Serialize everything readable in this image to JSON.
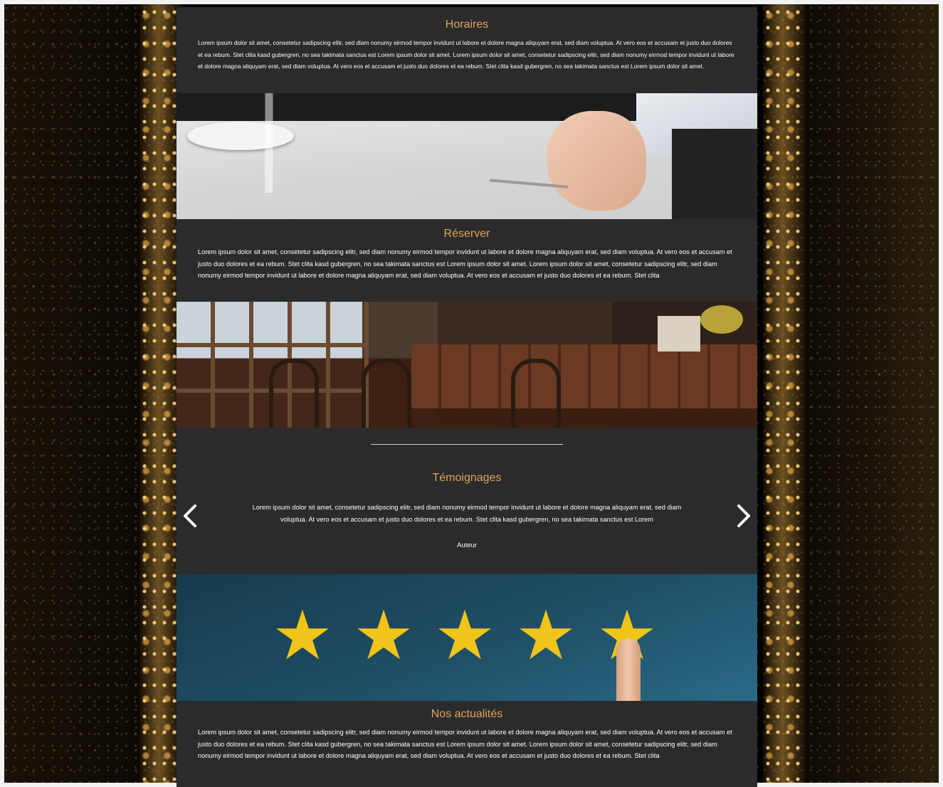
{
  "sections": {
    "horaires": {
      "title": "Horaires",
      "text": "Lorem ipsum dolor sit amet, consetetur sadipscing elitr, sed diam nonumy eirmod tempor invidunt ut labore et dolore magna aliquyam erat, sed diam voluptua. At vero eos et accusam et justo duo dolores et ea rebum. Stet clita kasd gubergren, no sea takimata sanctus est Lorem ipsum dolor sit amet. Lorem ipsum dolor sit amet, consetetur sadipscing elitr, sed diam nonumy eirmod tempor invidunt ut labore et dolore magna aliquyam erat, sed diam voluptua. At vero eos et accusam et justo duo dolores et ea rebum. Stet clita kasd gubergren, no sea takimata sanctus est Lorem ipsum dolor sit amet."
    },
    "reserver": {
      "title": "Réserver",
      "text": "Lorem ipsum dolor sit amet, consetetur sadipscing elitr, sed diam nonumy eirmod tempor invidunt ut labore et dolore magna aliquyam erat, sed diam voluptua. At vero eos et accusam et justo duo dolores et ea rebum. Stet clita kasd gubergren, no sea takimata sanctus est Lorem ipsum dolor sit amet. Lorem ipsum dolor sit amet, consetetur sadipscing elitr, sed diam nonumy eirmod tempor invidunt ut labore et dolore magna aliquyam erat, sed diam voluptua. At vero eos et accusam et justo duo dolores et ea rebum. Stet clita"
    },
    "temoignages": {
      "title": "Témoignages",
      "text": "Lorem ipsum dolor sit amet, consetetur sadipscing elitr, sed diam nonumy eirmod tempor invidunt ut labore et dolore magna aliquyam erat, sed diam voluptua. At vero eos et accusam et justo duo dolores et ea rebum. Stet clita kasd gubergren, no sea takimata sanctus est Lorem",
      "author": "Auteur"
    },
    "actualites": {
      "title": "Nos actualités",
      "text": "Lorem ipsum dolor sit amet, consetetur sadipscing elitr, sed diam nonumy eirmod tempor invidunt ut labore et dolore magna aliquyam erat, sed diam voluptua. At vero eos et accusam et justo duo dolores et ea rebum. Stet clita kasd gubergren, no sea takimata sanctus est Lorem ipsum dolor sit amet. Lorem ipsum dolor sit amet, consetetur sadipscing elitr, sed diam nonumy eirmod tempor invidunt ut labore et dolore magna aliquyam erat, sed diam voluptua. At vero eos et accusam et justo duo dolores et ea rebum. Stet clita"
    }
  },
  "carousel": {
    "prev_icon": "chevron-left-icon",
    "next_icon": "chevron-right-icon"
  },
  "rating_image": {
    "stars": 5
  },
  "colors": {
    "accent": "#e0a35b",
    "panel": "#2b2b2b",
    "text": "#ffffff",
    "star": "#f1c419"
  }
}
